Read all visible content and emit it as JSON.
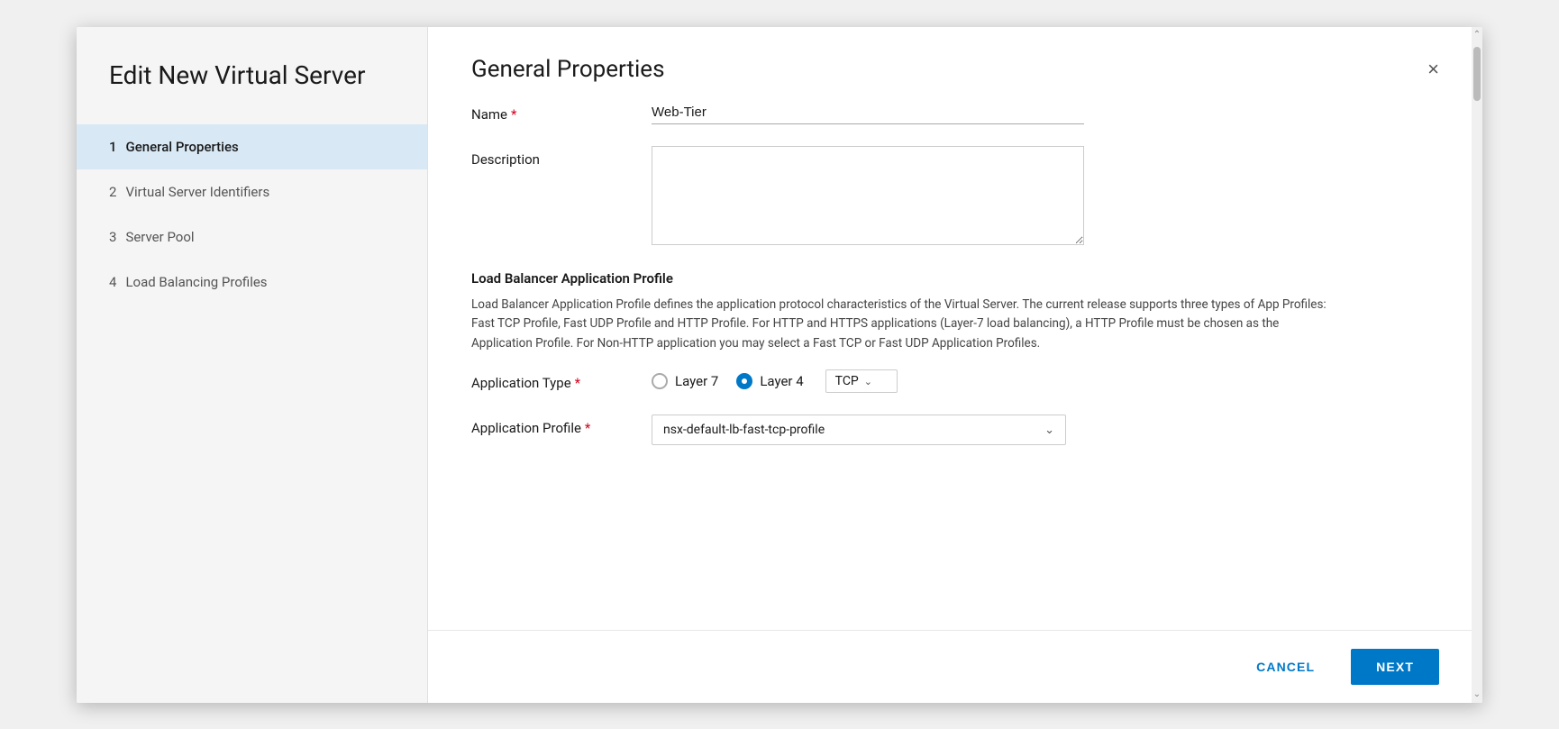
{
  "sidebar": {
    "title": "Edit New Virtual Server",
    "nav_items": [
      {
        "id": "general",
        "step": "1",
        "label": "General Properties",
        "active": true
      },
      {
        "id": "identifiers",
        "step": "2",
        "label": "Virtual Server Identifiers",
        "active": false
      },
      {
        "id": "pool",
        "step": "3",
        "label": "Server Pool",
        "active": false
      },
      {
        "id": "profiles",
        "step": "4",
        "label": "Load Balancing Profiles",
        "active": false
      }
    ]
  },
  "content": {
    "title": "General Properties",
    "close_label": "×",
    "form": {
      "name_label": "Name",
      "name_value": "Web-Tier",
      "desc_label": "Description",
      "desc_value": "",
      "lb_section_title": "Load Balancer Application Profile",
      "lb_section_desc": "Load Balancer Application Profile defines the application protocol characteristics of the Virtual Server. The current release supports three types of App Profiles: Fast TCP Profile, Fast UDP Profile and HTTP Profile. For HTTP and HTTPS applications (Layer-7 load balancing), a HTTP Profile must be chosen as the Application Profile. For Non-HTTP application you may select a Fast TCP or Fast UDP Application Profiles.",
      "app_type_label": "Application Type",
      "layer7_label": "Layer 7",
      "layer4_label": "Layer 4",
      "tcp_label": "TCP",
      "app_profile_label": "Application Profile",
      "app_profile_value": "nsx-default-lb-fast-tcp-profile"
    }
  },
  "footer": {
    "cancel_label": "CANCEL",
    "next_label": "NEXT"
  },
  "icons": {
    "close": "×",
    "chevron_down": "∨",
    "chevron_up": "∧"
  }
}
